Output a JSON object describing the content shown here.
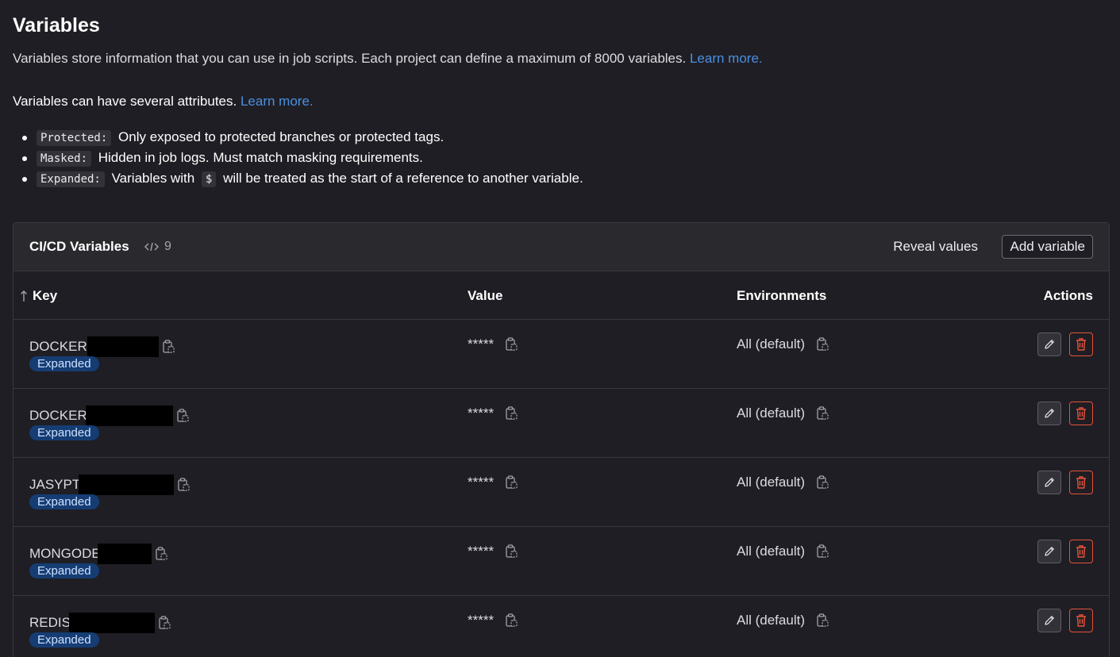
{
  "page": {
    "title": "Variables",
    "description": "Variables store information that you can use in job scripts. Each project can define a maximum of 8000 variables.",
    "learn_more_1": "Learn more.",
    "attributes_intro": "Variables can have several attributes.",
    "learn_more_2": "Learn more.",
    "attributes": [
      {
        "code": "Protected:",
        "text": "Only exposed to protected branches or protected tags."
      },
      {
        "code": "Masked:",
        "text": "Hidden in job logs. Must match masking requirements."
      },
      {
        "code": "Expanded:",
        "text_before": "Variables with",
        "dollar": "$",
        "text_after": "will be treated as the start of a reference to another variable."
      }
    ]
  },
  "card": {
    "title": "CI/CD Variables",
    "count": "9",
    "reveal_label": "Reveal values",
    "add_label": "Add variable"
  },
  "table": {
    "headers": {
      "key": "Key",
      "value": "Value",
      "environments": "Environments",
      "actions": "Actions"
    },
    "rows": [
      {
        "key": "DOCKER",
        "badge": "Expanded",
        "value": "*****",
        "env": "All (default)"
      },
      {
        "key": "DOCKER",
        "badge": "Expanded",
        "value": "*****",
        "env": "All (default)"
      },
      {
        "key": "JASYPT",
        "badge": "Expanded",
        "value": "*****",
        "env": "All (default)"
      },
      {
        "key": "MONGODE",
        "badge": "Expanded",
        "value": "*****",
        "env": "All (default)"
      },
      {
        "key": "REDIS",
        "badge": "Expanded",
        "value": "*****",
        "env": "All (default)"
      }
    ]
  },
  "colors": {
    "background": "#1f1e24",
    "link": "#4a90e2",
    "badge_bg": "#153d74",
    "delete": "#e5533b"
  },
  "icons": [
    "sort-ascending-icon",
    "code-icon",
    "copy-clipboard-icon",
    "pencil-icon",
    "trash-icon"
  ]
}
